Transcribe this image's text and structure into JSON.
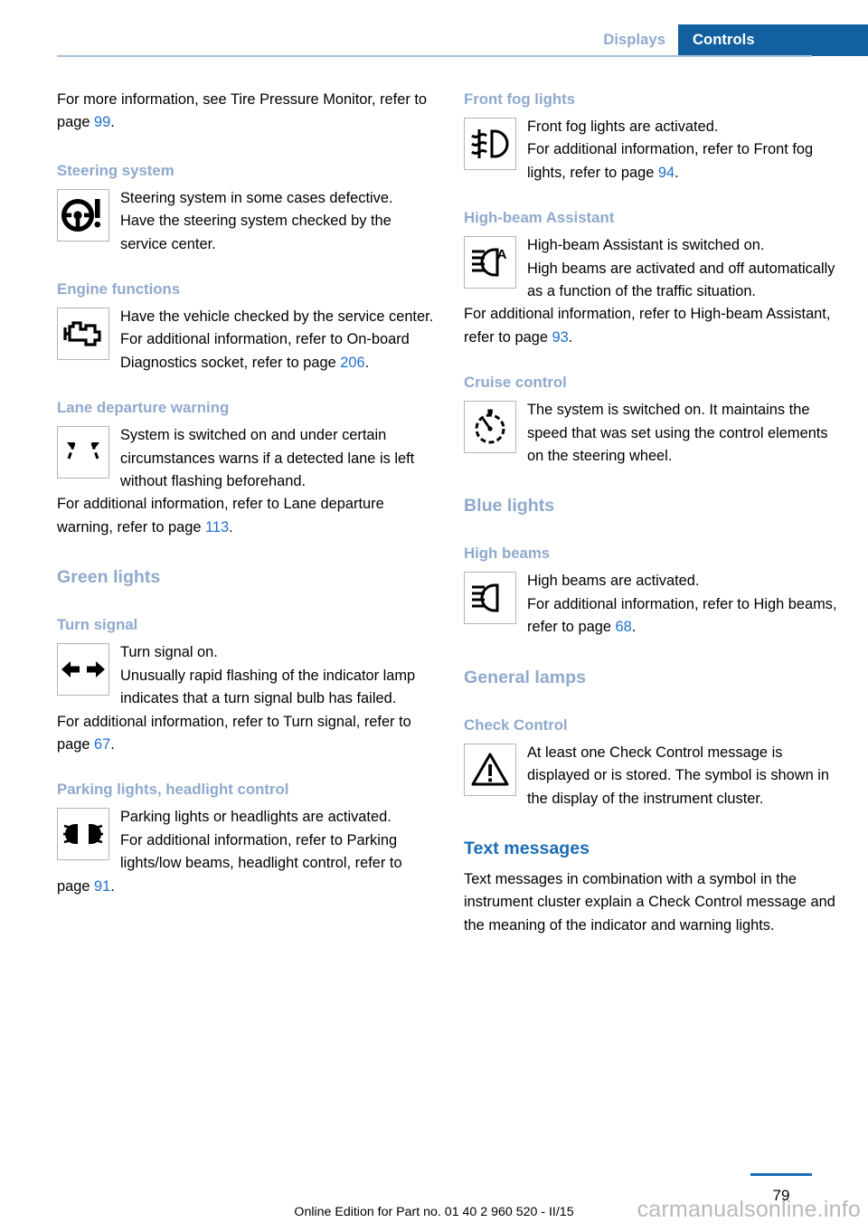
{
  "header": {
    "tab_inactive": "Displays",
    "tab_active": "Controls"
  },
  "colors": {
    "tab_active_bg": "#12609f",
    "heading_primary": "#1a6cb5",
    "heading_secondary": "#8fa9cc",
    "page_reference": "#1d6fd0",
    "rule": "#a9c0dd"
  },
  "left_column": {
    "intro": {
      "text_before": "For more information, see Tire Pressure Monitor, refer to page ",
      "ref": "99",
      "text_after": "."
    },
    "steering": {
      "heading": "Steering system",
      "icon": "steering-wheel-warning-icon",
      "line1": "Steering system in some cases defective.",
      "line2": "Have the steering system checked by the service center."
    },
    "engine": {
      "heading": "Engine functions",
      "icon": "check-engine-icon",
      "line1": "Have the vehicle checked by the service center.",
      "line2_before": "For additional information, refer to On-board Diagnostics socket, refer to page ",
      "line2_ref": "206",
      "line2_after": "."
    },
    "lane": {
      "heading": "Lane departure warning",
      "icon": "lane-departure-warning-icon",
      "line1": "System is switched on and under certain circumstances warns if a detected lane is left without flashing beforehand.",
      "line2_before": "For additional information, refer to Lane departure warning, refer to page ",
      "line2_ref": "113",
      "line2_after": "."
    },
    "green_lights": {
      "heading": "Green lights",
      "turn_signal": {
        "heading": "Turn signal",
        "icon": "turn-signal-arrows-icon",
        "line1": "Turn signal on.",
        "line2": "Unusually rapid flashing of the indicator lamp indicates that a turn signal bulb has failed.",
        "line3_before": "For additional information, refer to Turn signal, refer to page ",
        "line3_ref": "67",
        "line3_after": "."
      },
      "parking": {
        "heading": "Parking lights, headlight control",
        "icon": "parking-lights-icon",
        "line1": "Parking lights or headlights are activated.",
        "line2_before": "For additional information, refer to Parking lights/low beams, headlight control, refer to page ",
        "line2_ref": "91",
        "line2_after": "."
      }
    }
  },
  "right_column": {
    "fog": {
      "heading": "Front fog lights",
      "icon": "front-fog-light-icon",
      "line1": "Front fog lights are activated.",
      "line2_before": "For additional information, refer to Front fog lights, refer to page ",
      "line2_ref": "94",
      "line2_after": "."
    },
    "high_beam_assistant": {
      "heading": "High-beam Assistant",
      "icon": "high-beam-assistant-icon",
      "line1": "High-beam Assistant is switched on.",
      "line2": "High beams are activated and off automatically as a function of the traffic situation.",
      "line3_before": "For additional information, refer to High-beam Assistant, refer to page ",
      "line3_ref": "93",
      "line3_after": "."
    },
    "cruise": {
      "heading": "Cruise control",
      "icon": "cruise-control-speedometer-icon",
      "line1": "The system is switched on. It maintains the speed that was set using the control elements on the steering wheel."
    },
    "blue_lights": {
      "heading": "Blue lights",
      "high_beams": {
        "heading": "High beams",
        "icon": "high-beam-icon",
        "line1": "High beams are activated.",
        "line2_before": "For additional information, refer to High beams, refer to page ",
        "line2_ref": "68",
        "line2_after": "."
      }
    },
    "general_lamps": {
      "heading": "General lamps",
      "check_control": {
        "heading": "Check Control",
        "icon": "warning-triangle-icon",
        "line1": "At least one Check Control message is displayed or is stored. The symbol is shown in the display of the instrument cluster."
      }
    },
    "text_messages": {
      "heading": "Text messages",
      "body": "Text messages in combination with a symbol in the instrument cluster explain a Check Control message and the meaning of the indicator and warning lights."
    }
  },
  "footer": {
    "edition": "Online Edition for Part no. 01 40 2 960 520 - II/15",
    "page_number": "79",
    "watermark": "carmanualsonline.info"
  }
}
